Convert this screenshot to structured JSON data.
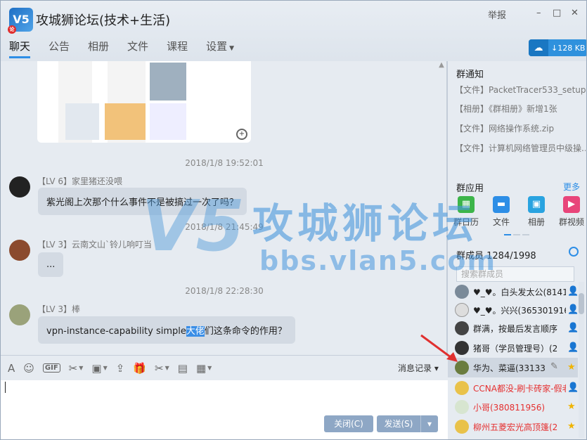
{
  "window": {
    "logo_text": "V5",
    "logo_badge": "论",
    "title": "攻城狮论坛(技术+生活)",
    "report": "举报",
    "controls": [
      "–",
      "□",
      "✕"
    ]
  },
  "tabs": [
    {
      "label": "聊天"
    },
    {
      "label": "公告"
    },
    {
      "label": "相册"
    },
    {
      "label": "文件"
    },
    {
      "label": "课程"
    },
    {
      "label": "设置"
    }
  ],
  "speed": {
    "value": "128 KB",
    "arrow": "↓"
  },
  "messages": [
    {
      "timestamp": "2018/1/8 19:52:01",
      "level": "【LV 6】",
      "sender": "家里猪还没喂",
      "text": "紫光阁上次那个什么事件不是被搞过一次了吗？"
    },
    {
      "timestamp": "2018/1/8 21:45:49",
      "level": "【LV 3】",
      "sender": "云南文山`铃儿响叮当",
      "text": "..."
    },
    {
      "timestamp": "2018/1/8 22:28:30",
      "level": "【LV 3】",
      "sender": "棒",
      "text_before": "vpn-instance-capability simple",
      "text_highlight": "大佬",
      "text_after": "们这条命令的作用？"
    }
  ],
  "watermark": {
    "logo": "V5",
    "name": "攻城狮论坛",
    "url": "bbs.vlan5.com"
  },
  "toolbar": {
    "tools": [
      "A",
      "☺",
      "GIF",
      "✂",
      "▣",
      "⇪",
      "🎁",
      "✂",
      "▤",
      "▦"
    ],
    "record": "消息记录",
    "record_caret": "▾"
  },
  "buttons": {
    "close": "关闭(C)",
    "send": "发送(S)",
    "send_caret": "▾"
  },
  "group_notice": {
    "title": "群通知",
    "items": [
      "【文件】PacketTracer533_setup.exe",
      "【相册】《群相册》新增1张",
      "【文件】网络操作系统.zip",
      "【文件】计算机网络管理员中级操..."
    ]
  },
  "group_apps": {
    "title": "群应用",
    "more": "更多",
    "apps": [
      {
        "label": "群日历",
        "icon": "calendar-icon",
        "color": "#3cb54a",
        "glyph": "▦"
      },
      {
        "label": "文件",
        "icon": "folder-icon",
        "color": "#2d8ee6",
        "glyph": "▬"
      },
      {
        "label": "相册",
        "icon": "photo-icon",
        "color": "#29a3e0",
        "glyph": "▣"
      },
      {
        "label": "群视频",
        "icon": "video-icon",
        "color": "#e8457a",
        "glyph": "▶"
      }
    ]
  },
  "members": {
    "title": "群成员 1284/1998",
    "search_placeholder": "搜索群成员",
    "list": [
      {
        "name": "♥_♥。白头发太公(814130",
        "red": false,
        "badge": "👤"
      },
      {
        "name": "♥_♥。兴兴(365301916)",
        "red": false,
        "badge": "👤"
      },
      {
        "name": "群满，按最后发言顺序",
        "red": false,
        "badge": "👤"
      },
      {
        "name": "猪哥（学员管理号）(2",
        "red": false,
        "badge": "👤"
      },
      {
        "name": "华为、菜逼(33133",
        "red": false,
        "badge": "★"
      },
      {
        "name": "CCNA都没-刷卡砖家-假老板",
        "red": true,
        "badge": "👤"
      },
      {
        "name": "小哥(380811956)",
        "red": true,
        "badge": "★"
      },
      {
        "name": "柳州五菱宏光高顶篷(2",
        "red": true,
        "badge": "★"
      }
    ]
  }
}
